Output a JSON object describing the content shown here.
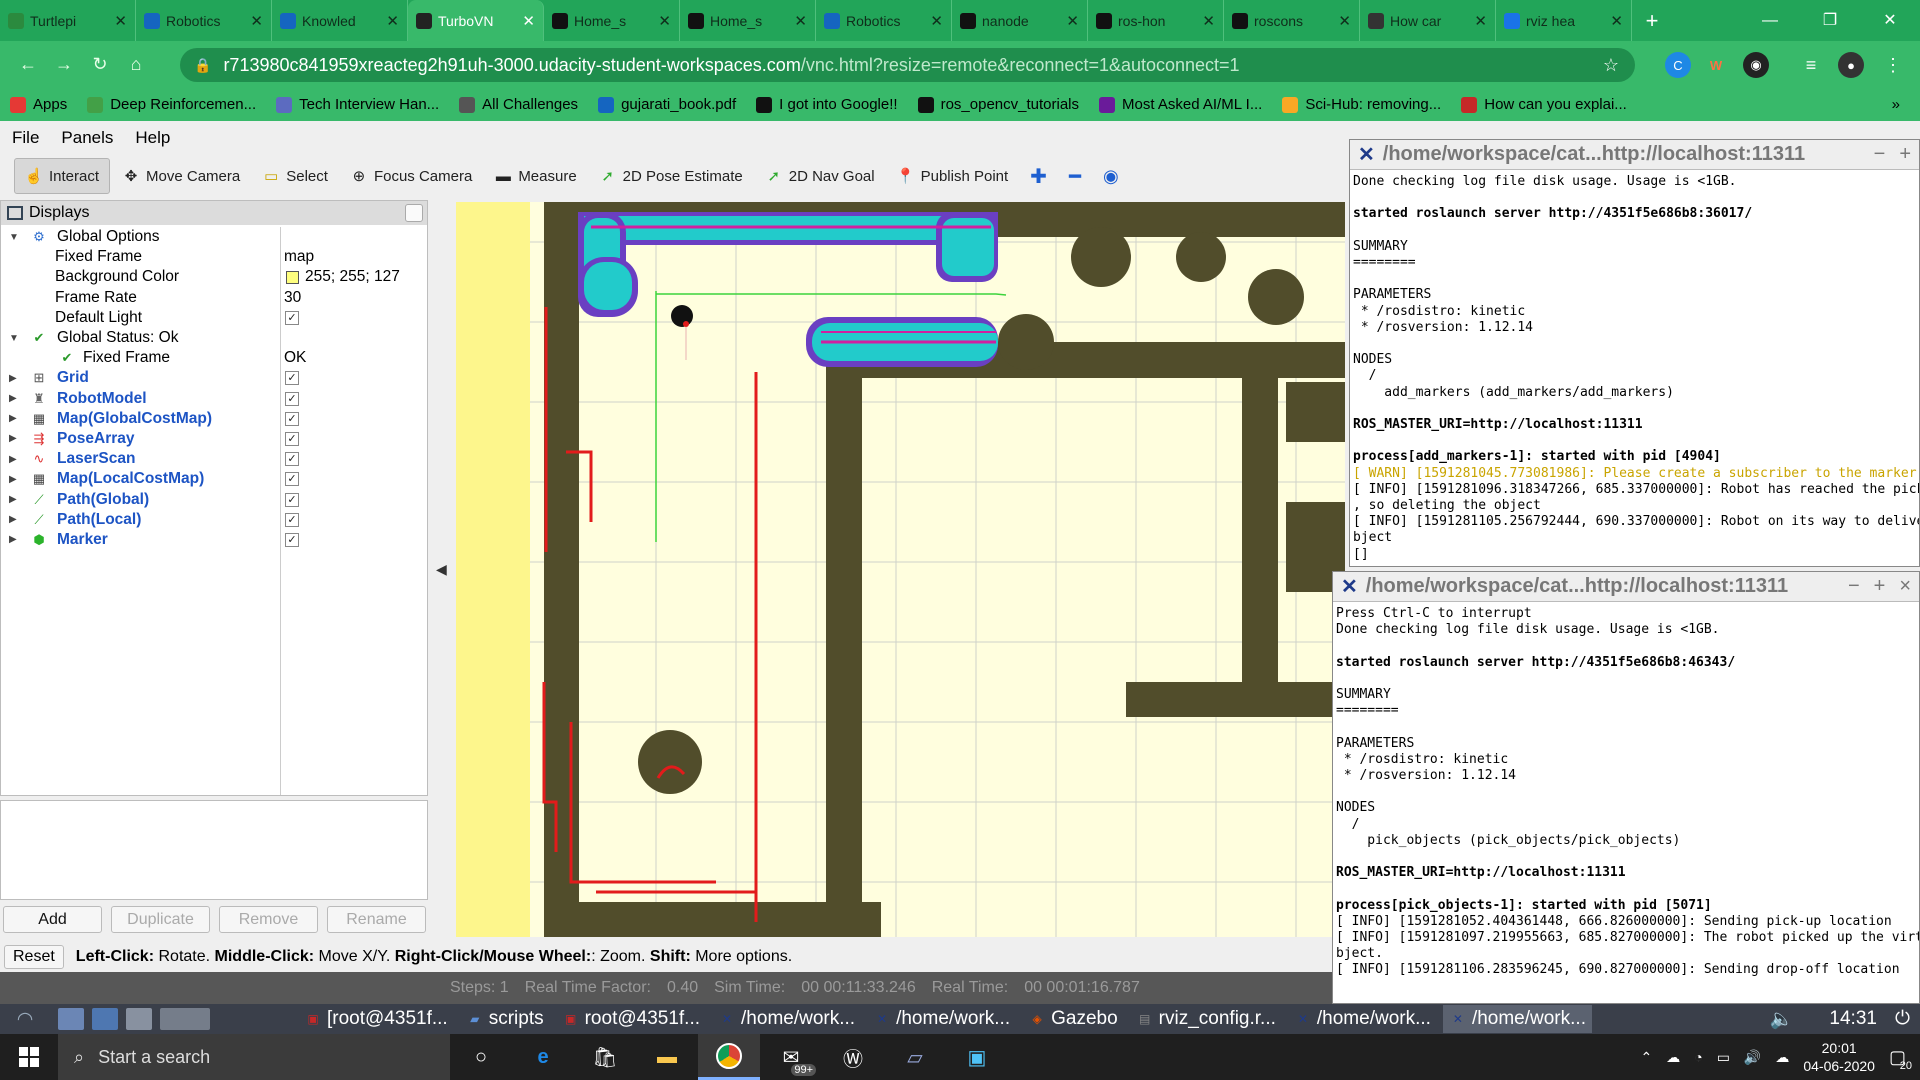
{
  "browser": {
    "tabs": [
      {
        "title": "Turtlepi",
        "fav": "#2b8a3e",
        "active": false
      },
      {
        "title": "Robotics",
        "fav": "#1565c0",
        "active": false
      },
      {
        "title": "Knowled",
        "fav": "#1565c0",
        "active": false
      },
      {
        "title": "TurboVN",
        "fav": "#222222",
        "active": true
      },
      {
        "title": "Home_s",
        "fav": "#111111",
        "active": false
      },
      {
        "title": "Home_s",
        "fav": "#111111",
        "active": false
      },
      {
        "title": "Robotics",
        "fav": "#1565c0",
        "active": false
      },
      {
        "title": "nanode",
        "fav": "#111111",
        "active": false
      },
      {
        "title": "ros-hon",
        "fav": "#111111",
        "active": false
      },
      {
        "title": "roscons",
        "fav": "#111111",
        "active": false
      },
      {
        "title": "How car",
        "fav": "#333333",
        "active": false
      },
      {
        "title": "rviz hea",
        "fav": "#1a73e8",
        "active": false
      }
    ],
    "new_tab": "+",
    "url_host": "r713980c841959xreacteg2h91uh-3000.udacity-student-workspaces.com",
    "url_path": "/vnc.html?resize=remote&reconnect=1&autoconnect=1",
    "bookmarks": [
      {
        "label": "Apps",
        "icon": "apps-icon",
        "color": "#e53935"
      },
      {
        "label": "Deep Reinforcemen...",
        "icon": "plus-doc-icon",
        "color": "#43a047"
      },
      {
        "label": "Tech Interview Han...",
        "icon": "code-icon",
        "color": "#5c6bc0"
      },
      {
        "label": "All Challenges",
        "icon": "challenge-icon",
        "color": "#555555"
      },
      {
        "label": "gujarati_book.pdf",
        "icon": "w-icon",
        "color": "#1565c0"
      },
      {
        "label": "I got into Google!!",
        "icon": "m-icon",
        "color": "#111111"
      },
      {
        "label": "ros_opencv_tutorials",
        "icon": "github-icon",
        "color": "#111111"
      },
      {
        "label": "Most Asked AI/ML I...",
        "icon": "dollar-icon",
        "color": "#6a1b9a"
      },
      {
        "label": "Sci-Hub: removing...",
        "icon": "scihub-icon",
        "color": "#f9a825"
      },
      {
        "label": "How can you explai...",
        "icon": "quora-icon",
        "color": "#c62828"
      }
    ],
    "bookmarks_more": "»"
  },
  "rviz": {
    "menu": [
      "File",
      "Panels",
      "Help"
    ],
    "tools": [
      {
        "label": "Interact",
        "icon": "hand-icon",
        "active": true
      },
      {
        "label": "Move Camera",
        "icon": "move-camera-icon",
        "active": false
      },
      {
        "label": "Select",
        "icon": "select-icon",
        "active": false
      },
      {
        "label": "Focus Camera",
        "icon": "focus-camera-icon",
        "active": false
      },
      {
        "label": "Measure",
        "icon": "ruler-icon",
        "active": false
      },
      {
        "label": "2D Pose Estimate",
        "icon": "pose-arrow-icon",
        "active": false
      },
      {
        "label": "2D Nav Goal",
        "icon": "nav-goal-icon",
        "active": false
      },
      {
        "label": "Publish Point",
        "icon": "pin-icon",
        "active": false
      }
    ],
    "displays_title": "Displays",
    "tree": [
      {
        "depth": 0,
        "arrow": "▼",
        "icon": "gear-icon",
        "label": "Global Options",
        "value": "",
        "check": null,
        "link": false
      },
      {
        "depth": 1,
        "arrow": "",
        "icon": "",
        "label": "Fixed Frame",
        "value": "map",
        "check": null,
        "link": false
      },
      {
        "depth": 1,
        "arrow": "",
        "icon": "",
        "label": "Background Color",
        "value": "255; 255; 127",
        "swatch": "#ffff7f",
        "check": null,
        "link": false
      },
      {
        "depth": 1,
        "arrow": "",
        "icon": "",
        "label": "Frame Rate",
        "value": "30",
        "check": null,
        "link": false
      },
      {
        "depth": 1,
        "arrow": "",
        "icon": "",
        "label": "Default Light",
        "value": "",
        "check": true,
        "link": false
      },
      {
        "depth": 0,
        "arrow": "▼",
        "icon": "check-icon",
        "label": "Global Status: Ok",
        "value": "",
        "check": null,
        "link": false
      },
      {
        "depth": 1,
        "arrow": "",
        "icon": "check-icon",
        "label": "Fixed Frame",
        "value": "OK",
        "check": null,
        "link": false
      },
      {
        "depth": 0,
        "arrow": "▶",
        "icon": "grid-icon",
        "label": "Grid",
        "value": "",
        "check": true,
        "link": true
      },
      {
        "depth": 0,
        "arrow": "▶",
        "icon": "robot-icon",
        "label": "RobotModel",
        "value": "",
        "check": true,
        "link": true
      },
      {
        "depth": 0,
        "arrow": "▶",
        "icon": "map-icon",
        "label": "Map(GlobalCostMap)",
        "value": "",
        "check": true,
        "link": true
      },
      {
        "depth": 0,
        "arrow": "▶",
        "icon": "pose-array-icon",
        "label": "PoseArray",
        "value": "",
        "check": true,
        "link": true
      },
      {
        "depth": 0,
        "arrow": "▶",
        "icon": "laser-icon",
        "label": "LaserScan",
        "value": "",
        "check": true,
        "link": true
      },
      {
        "depth": 0,
        "arrow": "▶",
        "icon": "map-icon",
        "label": "Map(LocalCostMap)",
        "value": "",
        "check": true,
        "link": true
      },
      {
        "depth": 0,
        "arrow": "▶",
        "icon": "path-icon",
        "label": "Path(Global)",
        "value": "",
        "check": true,
        "link": true
      },
      {
        "depth": 0,
        "arrow": "▶",
        "icon": "path-icon",
        "label": "Path(Local)",
        "value": "",
        "check": true,
        "link": true
      },
      {
        "depth": 0,
        "arrow": "▶",
        "icon": "marker-icon",
        "label": "Marker",
        "value": "",
        "check": true,
        "link": true
      }
    ],
    "panel_buttons": [
      {
        "label": "Add",
        "enabled": true
      },
      {
        "label": "Duplicate",
        "enabled": false
      },
      {
        "label": "Remove",
        "enabled": false
      },
      {
        "label": "Rename",
        "enabled": false
      }
    ],
    "status": {
      "reset": "Reset",
      "k1": "Left-Click:",
      "v1": "Rotate.",
      "k2": "Middle-Click:",
      "v2": "Move X/Y.",
      "k3": "Right-Click/Mouse Wheel:",
      "v3": ": Zoom.",
      "k4": "Shift:",
      "v4": "More options."
    },
    "gazebo_bar": [
      "Steps: 1",
      "Real Time Factor:",
      "0.40",
      "Sim Time:",
      "00 00:11:33.246",
      "Real Time:",
      "00 00:01:16.787"
    ]
  },
  "terminals": [
    {
      "title": "/home/workspace/cat...http://localhost:11311",
      "lines": [
        {
          "t": "Done checking log file disk usage. Usage is <1GB.",
          "s": ""
        },
        {
          "t": "",
          "s": ""
        },
        {
          "t": "started roslaunch server http://4351f5e686b8:36017/",
          "s": "b"
        },
        {
          "t": "",
          "s": ""
        },
        {
          "t": "SUMMARY",
          "s": ""
        },
        {
          "t": "========",
          "s": ""
        },
        {
          "t": "",
          "s": ""
        },
        {
          "t": "PARAMETERS",
          "s": ""
        },
        {
          "t": " * /rosdistro: kinetic",
          "s": ""
        },
        {
          "t": " * /rosversion: 1.12.14",
          "s": ""
        },
        {
          "t": "",
          "s": ""
        },
        {
          "t": "NODES",
          "s": ""
        },
        {
          "t": "  /",
          "s": ""
        },
        {
          "t": "    add_markers (add_markers/add_markers)",
          "s": ""
        },
        {
          "t": "",
          "s": ""
        },
        {
          "t": "ROS_MASTER_URI=http://localhost:11311",
          "s": "b"
        },
        {
          "t": "",
          "s": ""
        },
        {
          "t": "process[add_markers-1]: started with pid [4904]",
          "s": "b"
        },
        {
          "t": "[ WARN] [1591281045.773081986]: Please create a subscriber to the marker",
          "s": "w"
        },
        {
          "t": "[ INFO] [1591281096.318347266, 685.337000000]: Robot has reached the picku",
          "s": ""
        },
        {
          "t": ", so deleting the object",
          "s": ""
        },
        {
          "t": "[ INFO] [1591281105.256792444, 690.337000000]: Robot on its way to deliver t",
          "s": ""
        },
        {
          "t": "bject",
          "s": ""
        },
        {
          "t": "[]",
          "s": ""
        }
      ]
    },
    {
      "title": "/home/workspace/cat...http://localhost:11311",
      "lines": [
        {
          "t": "Press Ctrl-C to interrupt",
          "s": ""
        },
        {
          "t": "Done checking log file disk usage. Usage is <1GB.",
          "s": ""
        },
        {
          "t": "",
          "s": ""
        },
        {
          "t": "started roslaunch server http://4351f5e686b8:46343/",
          "s": "b"
        },
        {
          "t": "",
          "s": ""
        },
        {
          "t": "SUMMARY",
          "s": ""
        },
        {
          "t": "========",
          "s": ""
        },
        {
          "t": "",
          "s": ""
        },
        {
          "t": "PARAMETERS",
          "s": ""
        },
        {
          "t": " * /rosdistro: kinetic",
          "s": ""
        },
        {
          "t": " * /rosversion: 1.12.14",
          "s": ""
        },
        {
          "t": "",
          "s": ""
        },
        {
          "t": "NODES",
          "s": ""
        },
        {
          "t": "  /",
          "s": ""
        },
        {
          "t": "    pick_objects (pick_objects/pick_objects)",
          "s": ""
        },
        {
          "t": "",
          "s": ""
        },
        {
          "t": "ROS_MASTER_URI=http://localhost:11311",
          "s": "b"
        },
        {
          "t": "",
          "s": ""
        },
        {
          "t": "process[pick_objects-1]: started with pid [5071]",
          "s": "b"
        },
        {
          "t": "[ INFO] [1591281052.404361448, 666.826000000]: Sending pick-up location",
          "s": ""
        },
        {
          "t": "[ INFO] [1591281097.219955663, 685.827000000]: The robot picked up the virtual",
          "s": ""
        },
        {
          "t": "bject.",
          "s": ""
        },
        {
          "t": "[ INFO] [1591281106.283596245, 690.827000000]: Sending drop-off location",
          "s": ""
        }
      ]
    }
  ],
  "vnc_taskbar": [
    {
      "label": "[root@4351f...",
      "icon": "terminal-icon",
      "active": false
    },
    {
      "label": "scripts",
      "icon": "folder-icon",
      "active": false
    },
    {
      "label": "root@4351f...",
      "icon": "terminal-icon",
      "active": false
    },
    {
      "label": "/home/work...",
      "icon": "ros-icon",
      "active": false
    },
    {
      "label": "/home/work...",
      "icon": "ros-icon",
      "active": false
    },
    {
      "label": "Gazebo",
      "icon": "gazebo-icon",
      "active": false
    },
    {
      "label": "rviz_config.r...",
      "icon": "rviz-icon",
      "active": false
    },
    {
      "label": "/home/work...",
      "icon": "ros-icon",
      "active": false
    },
    {
      "label": "/home/work...",
      "icon": "ros-icon",
      "active": true
    }
  ],
  "vnc_clock": "14:31",
  "windows": {
    "search_placeholder": "Start a search",
    "mail_badge": "99+",
    "time": "20:01",
    "date": "04-06-2020",
    "notif_count": "20"
  }
}
